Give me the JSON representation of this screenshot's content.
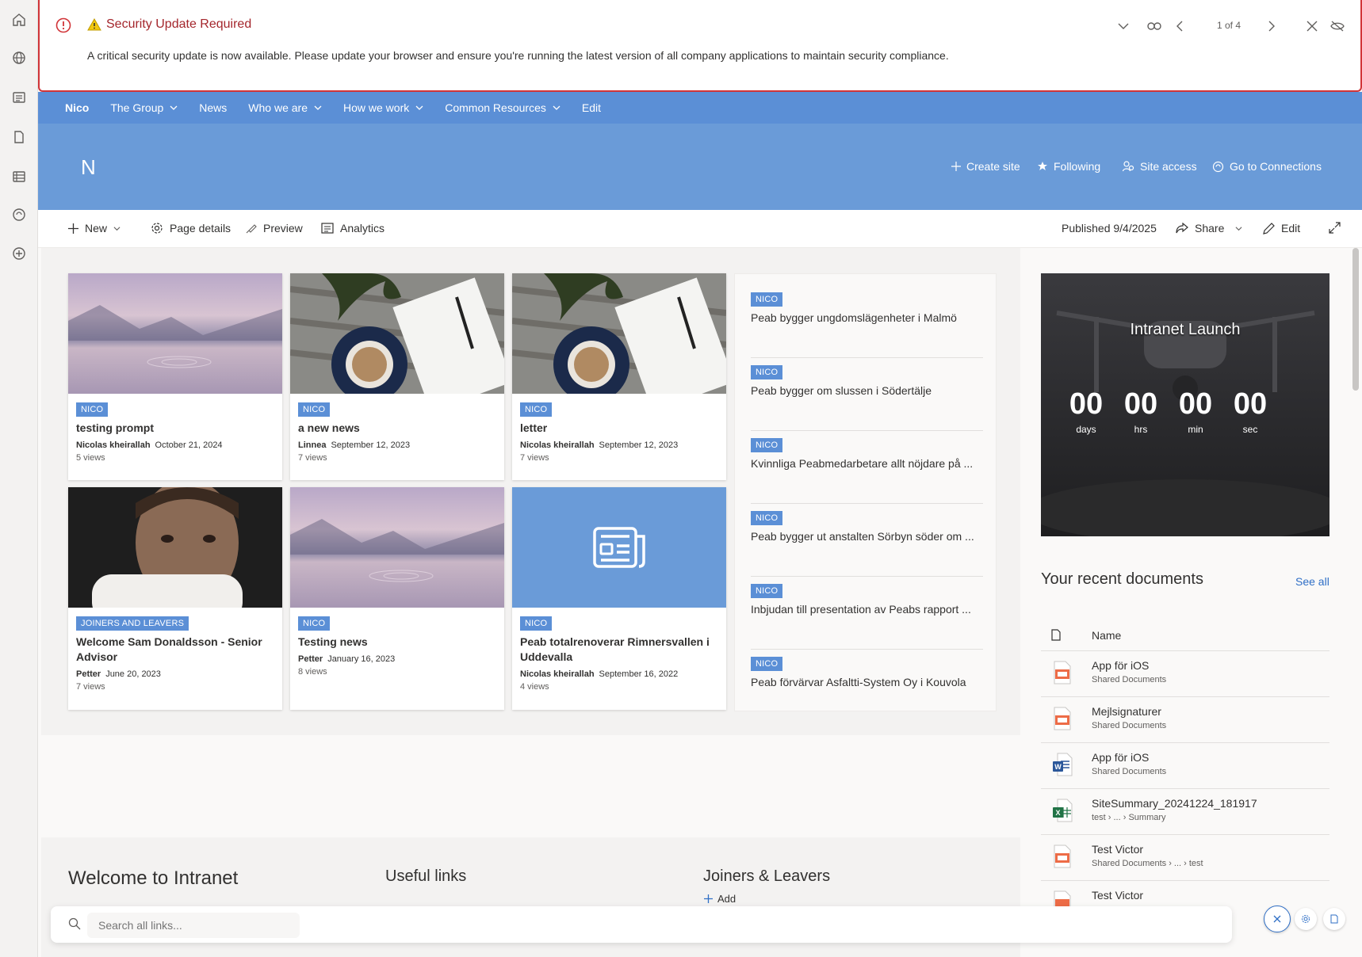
{
  "banner": {
    "title": "Security Update Required",
    "message": "A critical security update is now available. Please update your browser and ensure you're running the latest version of all company applications to maintain security compliance.",
    "pager": "1 of 4"
  },
  "nav": {
    "site": "Nico",
    "items": [
      {
        "label": "The Group",
        "dropdown": true
      },
      {
        "label": "News",
        "dropdown": false
      },
      {
        "label": "Who we are",
        "dropdown": true
      },
      {
        "label": "How we work",
        "dropdown": true
      },
      {
        "label": "Common Resources",
        "dropdown": true
      },
      {
        "label": "Edit",
        "dropdown": false
      }
    ]
  },
  "hero": {
    "logo": "N",
    "actions": {
      "create": "Create site",
      "following": "Following",
      "access": "Site access",
      "connections": "Go to Connections"
    }
  },
  "cmd": {
    "new": "New",
    "page_details": "Page details",
    "preview": "Preview",
    "analytics": "Analytics",
    "published": "Published 9/4/2025",
    "share": "Share",
    "edit": "Edit"
  },
  "cards": [
    {
      "tag": "NICO",
      "title": "testing prompt",
      "author": "Nicolas kheirallah",
      "date": "October 21, 2024",
      "views": "5 views"
    },
    {
      "tag": "NICO",
      "title": "a new news",
      "author": "Linnea",
      "date": "September 12, 2023",
      "views": "7 views"
    },
    {
      "tag": "NICO",
      "title": "letter",
      "author": "Nicolas kheirallah",
      "date": "September 12, 2023",
      "views": "7 views"
    },
    {
      "tag": "JOINERS AND LEAVERS",
      "title": "Welcome Sam Donaldsson - Senior Advisor",
      "author": "Petter",
      "date": "June 20, 2023",
      "views": "7 views"
    },
    {
      "tag": "NICO",
      "title": "Testing news",
      "author": "Petter",
      "date": "January 16, 2023",
      "views": "8 views"
    },
    {
      "tag": "NICO",
      "title": "Peab totalrenoverar Rimnersvallen i Uddevalla",
      "author": "Nicolas kheirallah",
      "date": "September 16, 2022",
      "views": "4 views"
    }
  ],
  "news_list": [
    {
      "tag": "NICO",
      "title": "Peab bygger ungdomslägenheter i Malmö"
    },
    {
      "tag": "NICO",
      "title": "Peab bygger om slussen i Södertälje"
    },
    {
      "tag": "NICO",
      "title": "Kvinnliga Peabmedarbetare allt nöjdare på ..."
    },
    {
      "tag": "NICO",
      "title": "Peab bygger ut anstalten Sörbyn söder om ..."
    },
    {
      "tag": "NICO",
      "title": "Inbjudan till presentation av Peabs rapport ..."
    },
    {
      "tag": "NICO",
      "title": "Peab förvärvar Asfaltti-System Oy i Kouvola"
    }
  ],
  "countdown": {
    "title": "Intranet Launch",
    "units": [
      {
        "value": "00",
        "label": "days"
      },
      {
        "value": "00",
        "label": "hrs"
      },
      {
        "value": "00",
        "label": "min"
      },
      {
        "value": "00",
        "label": "sec"
      }
    ]
  },
  "docs": {
    "heading": "Your recent documents",
    "see_all": "See all",
    "col_name": "Name",
    "items": [
      {
        "name": "App för iOS",
        "path": "Shared Documents",
        "type": "ppt"
      },
      {
        "name": "Mejlsignaturer",
        "path": "Shared Documents",
        "type": "ppt"
      },
      {
        "name": "App för iOS",
        "path": "Shared Documents",
        "type": "word"
      },
      {
        "name": "SiteSummary_20241224_181917",
        "path": "test › ... › Summary",
        "type": "excel"
      },
      {
        "name": "Test Victor",
        "path": "Shared Documents › ... › test",
        "type": "ppt"
      },
      {
        "name": "Test Victor",
        "path": "",
        "type": "ppt"
      }
    ]
  },
  "footer": {
    "welcome": "Welcome to Intranet",
    "useful": "Useful links",
    "joiners": "Joiners & Leavers",
    "add": "Add"
  },
  "search": {
    "placeholder": "Search all links..."
  },
  "colors": {
    "accent": "#5b8fd6",
    "hero": "#6a9bd8",
    "alert": "#d13438"
  }
}
